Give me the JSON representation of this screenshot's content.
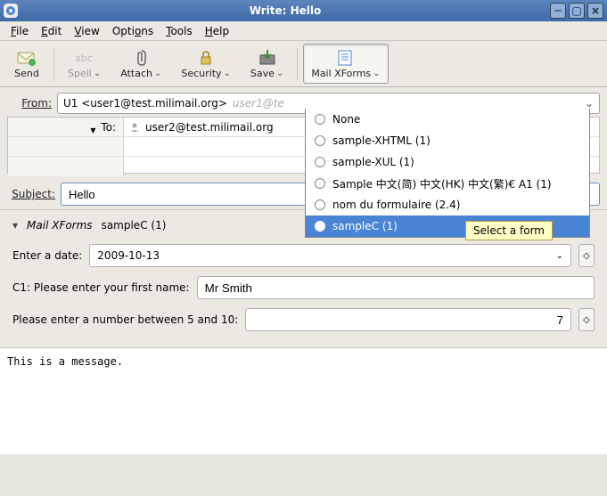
{
  "window": {
    "title": "Write: Hello"
  },
  "menu": {
    "file": "File",
    "edit": "Edit",
    "view": "View",
    "options": "Options",
    "tools": "Tools",
    "help": "Help"
  },
  "toolbar": {
    "send": "Send",
    "spell": "Spell",
    "attach": "Attach",
    "security": "Security",
    "save": "Save",
    "xforms": "Mail XForms"
  },
  "from": {
    "label": "From:",
    "value": "U1 <user1@test.milimail.org>",
    "ghost": "user1@te"
  },
  "addr": {
    "to_label": "To:",
    "to_value": "user2@test.milimail.org"
  },
  "subject": {
    "label": "Subject:",
    "value": "Hello"
  },
  "dropdown": {
    "options": [
      "None",
      "sample-XHTML (1)",
      "sample-XUL (1)",
      "Sample 中文(简) 中文(HK) 中文(繁)€ A1 (1)",
      "nom du formulaire (2.4)",
      "sampleC (1)"
    ],
    "selected_index": 5
  },
  "tooltip": "Select a form",
  "xforms": {
    "header_title": "Mail XForms",
    "header_form": "sampleC (1)",
    "date_label": "Enter a date:",
    "date_value": "2009-10-13",
    "name_label": "C1: Please enter your first name:",
    "name_value": "Mr Smith",
    "num_label": "Please enter a number between 5 and 10:",
    "num_value": "7"
  },
  "body": "This is a message."
}
